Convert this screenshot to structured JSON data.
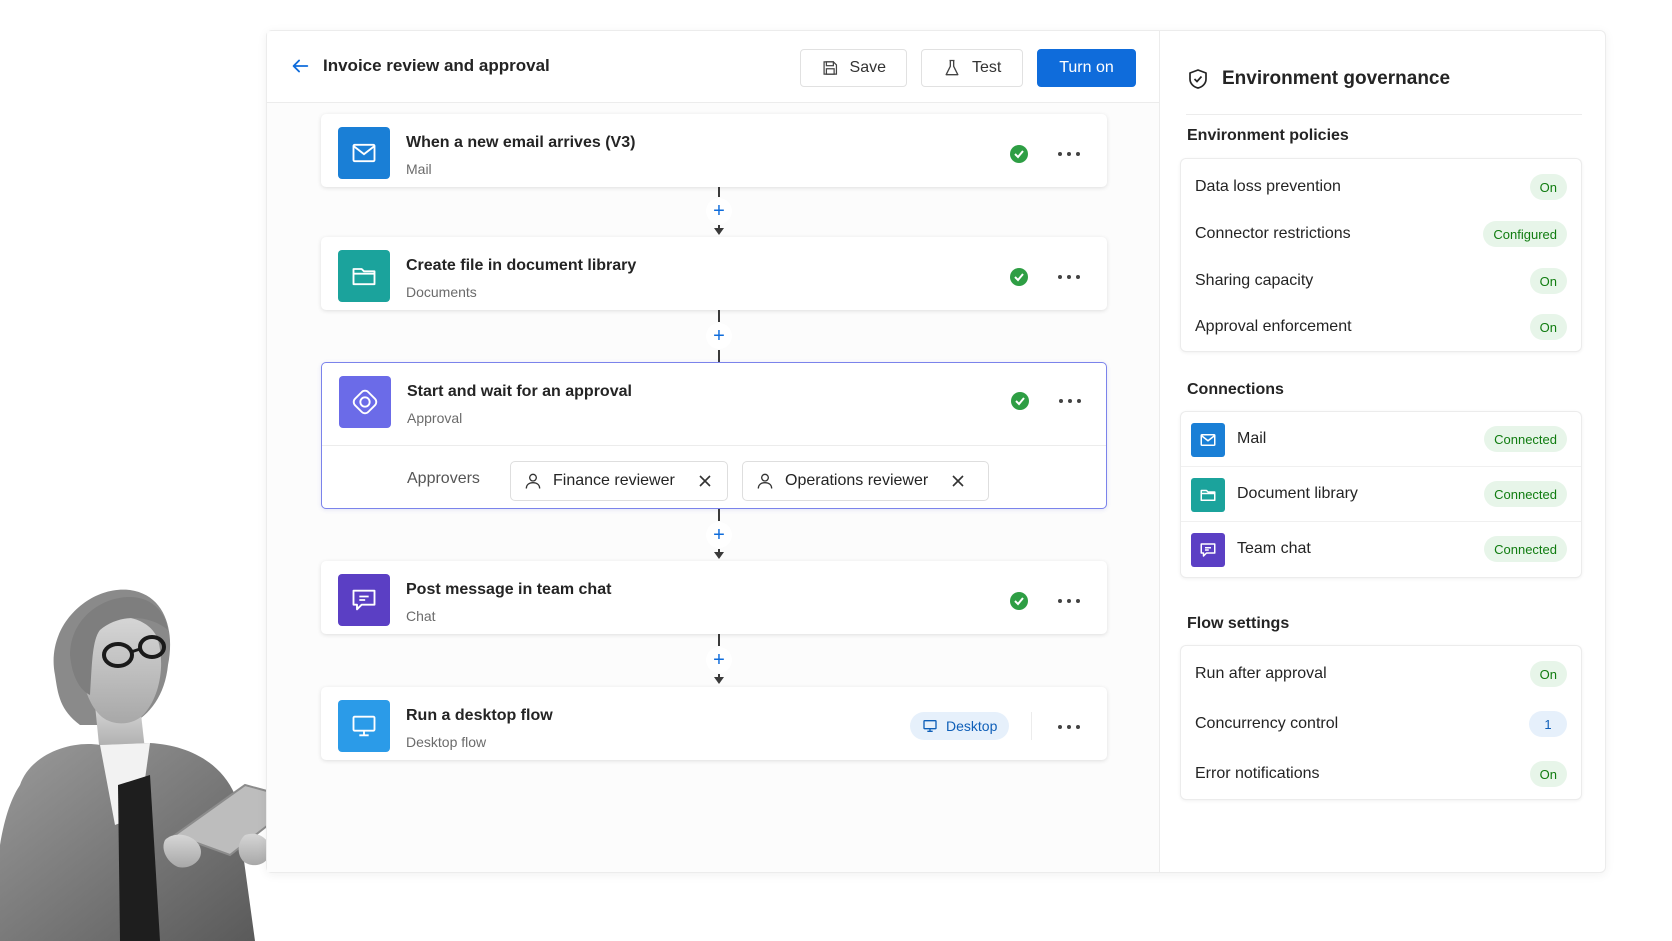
{
  "header": {
    "title": "Invoice review and approval",
    "save_label": "Save",
    "test_label": "Test",
    "turn_on_label": "Turn on"
  },
  "flow": {
    "steps": [
      {
        "title": "When a new email arrives (V3)",
        "subtitle": "Mail",
        "icon": "mail-icon",
        "color": "#1a7fd6"
      },
      {
        "title": "Create file in document library",
        "subtitle": "Documents",
        "icon": "folder-icon",
        "color": "#1ba39c"
      },
      {
        "title": "Start and wait for an approval",
        "subtitle": "Approval",
        "icon": "approval-icon",
        "color": "#6b6be8"
      },
      {
        "title": "Post message in team chat",
        "subtitle": "Chat",
        "icon": "chat-icon",
        "color": "#5b3fc4"
      },
      {
        "title": "Run a desktop flow",
        "subtitle": "Desktop flow",
        "icon": "monitor-icon",
        "color": "#2b9be8"
      }
    ],
    "approvers_label": "Approvers",
    "approvers": [
      "Finance reviewer",
      "Operations reviewer"
    ],
    "desktop_badge": "Desktop"
  },
  "side": {
    "title": "Environment governance",
    "policies_title": "Environment policies",
    "policies": [
      {
        "label": "Data loss prevention",
        "value": "On"
      },
      {
        "label": "Connector restrictions",
        "value": "Configured"
      },
      {
        "label": "Sharing capacity",
        "value": "On"
      },
      {
        "label": "Approval enforcement",
        "value": "On"
      }
    ],
    "connections_title": "Connections",
    "connections": [
      {
        "label": "Mail",
        "value": "Connected",
        "icon": "mail-icon"
      },
      {
        "label": "Document library",
        "value": "Connected",
        "icon": "folder-icon"
      },
      {
        "label": "Team chat",
        "value": "Connected",
        "icon": "chat-icon"
      }
    ],
    "settings_title": "Flow settings",
    "settings": [
      {
        "label": "Run after approval",
        "value": "On"
      },
      {
        "label": "Concurrency control",
        "value": "1"
      },
      {
        "label": "Error notifications",
        "value": "On"
      }
    ]
  },
  "colors": {
    "accent": "#0f6cdb",
    "success": "#107c10",
    "check": "#2e9e44"
  }
}
